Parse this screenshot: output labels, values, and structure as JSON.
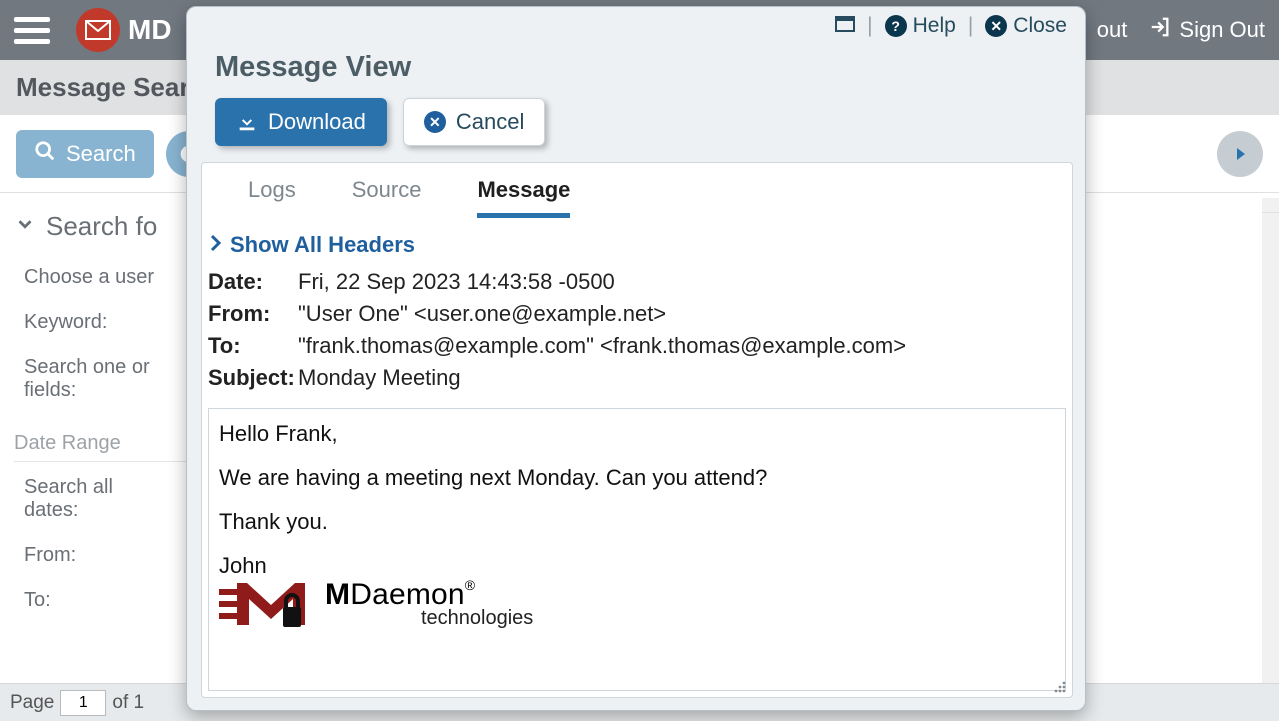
{
  "app": {
    "logo_text": "MD",
    "nav": {
      "about": "out",
      "signout": "Sign Out"
    }
  },
  "subheader": {
    "title": "Message Search"
  },
  "toolbar": {
    "search_label": "Search"
  },
  "sidebar": {
    "heading": "Search fo",
    "choose_user": "Choose a user",
    "keyword": "Keyword:",
    "search_one": "Search one or",
    "fields": "fields:",
    "date_range": "Date Range",
    "search_all": "Search all",
    "dates": "dates:",
    "from": "From:",
    "to": "To:"
  },
  "footer": {
    "page_label": "Page",
    "page_value": "1",
    "of": "of 1"
  },
  "modal": {
    "titlebar": {
      "help": "Help",
      "close": "Close"
    },
    "heading": "Message View",
    "buttons": {
      "download": "Download",
      "cancel": "Cancel"
    },
    "tabs": {
      "logs": "Logs",
      "source": "Source",
      "message": "Message"
    },
    "show_all_headers": "Show All Headers",
    "headers": {
      "date_k": "Date:",
      "date_v": "Fri, 22 Sep 2023 14:43:58 -0500",
      "from_k": "From:",
      "from_v": "\"User One\" <user.one@example.net>",
      "to_k": "To:",
      "to_v": "\"frank.thomas@example.com\" <frank.thomas@example.com>",
      "subj_k": "Subject:",
      "subj_v": "Monday Meeting"
    },
    "body": {
      "p1": "Hello Frank,",
      "p2": "We are having a meeting next Monday. Can you attend?",
      "p3": "Thank you.",
      "p4": "John",
      "sig_line1_bold": "M",
      "sig_line1_rest": "Daemon",
      "sig_line2": "technologies",
      "sig_reg": "®"
    }
  }
}
